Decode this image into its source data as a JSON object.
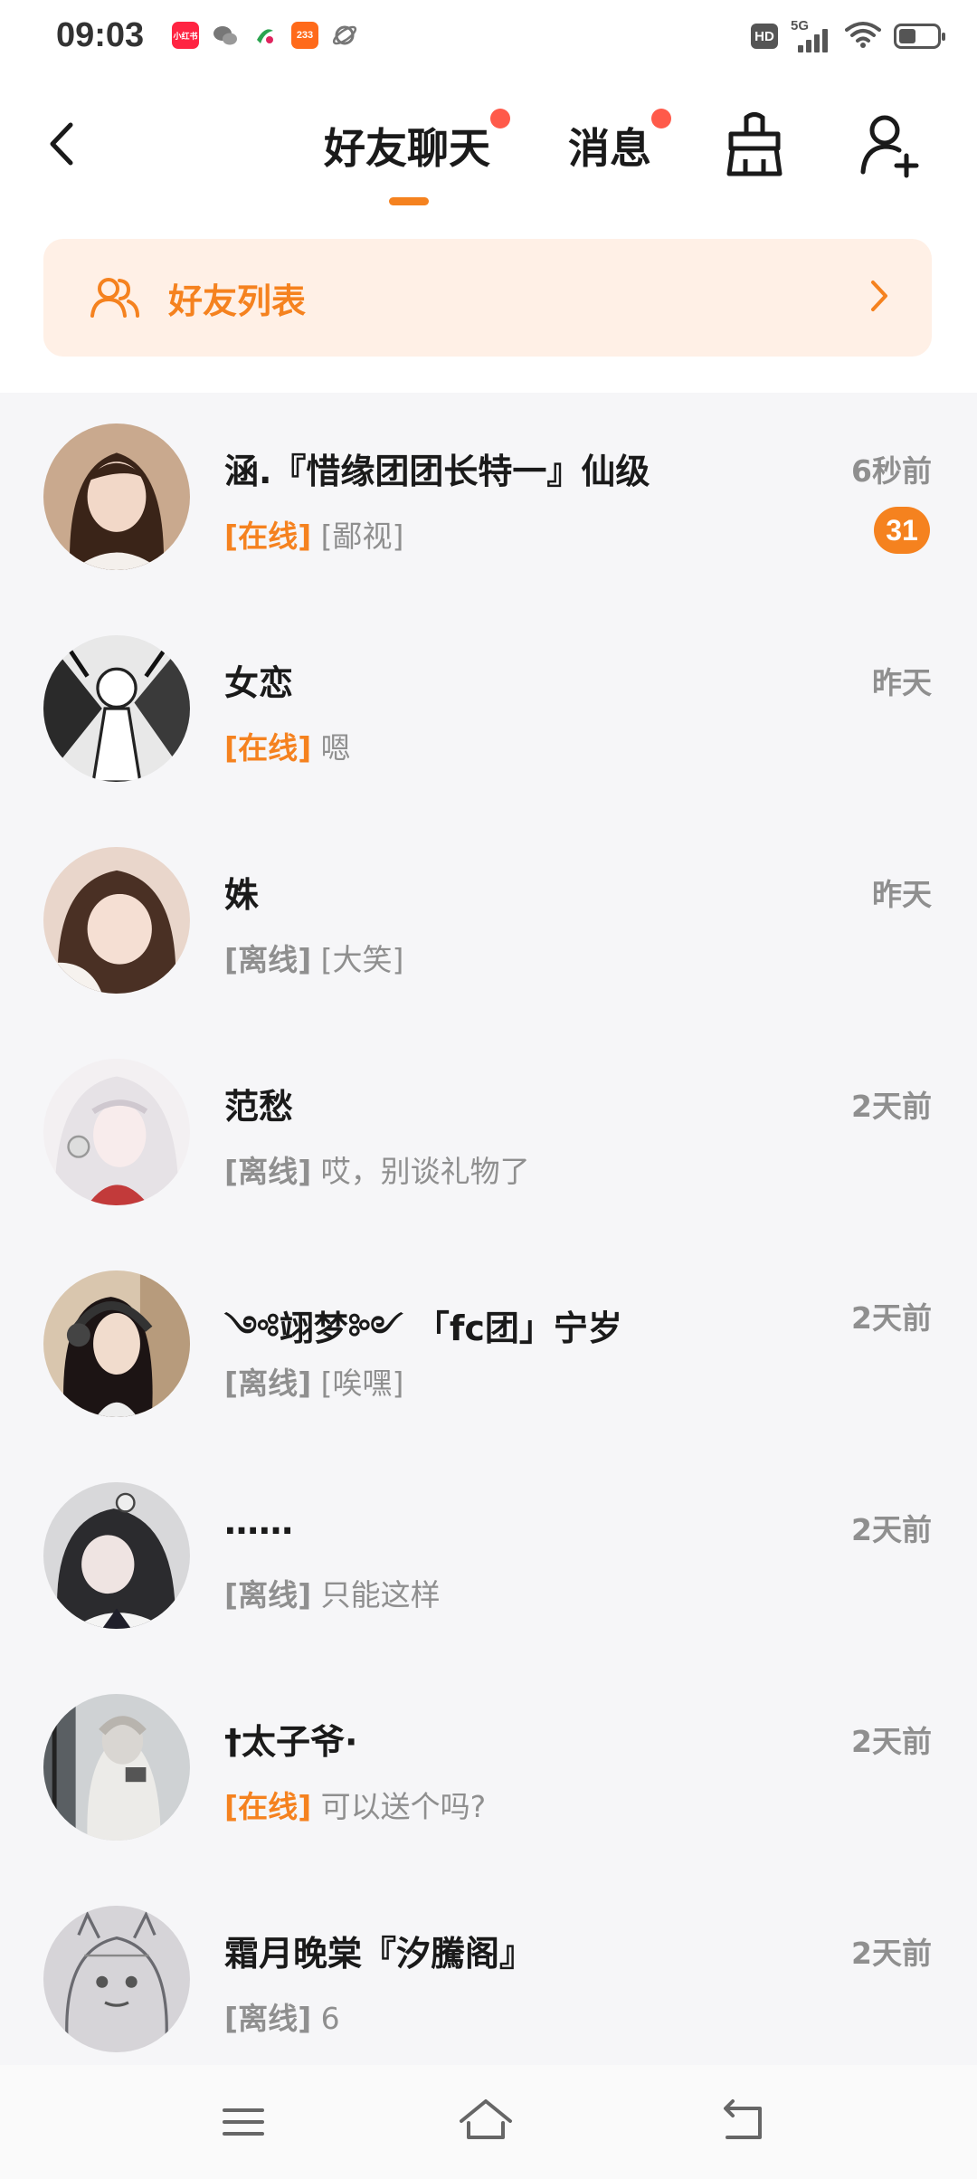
{
  "status_bar": {
    "time": "09:03",
    "hd": "HD",
    "network": "5G",
    "apps": [
      {
        "label": "小红书",
        "color": "#ff2442"
      },
      {
        "label": "",
        "color": "#9aa0a6"
      },
      {
        "label": "",
        "color": "#2aa44f"
      },
      {
        "label": "233",
        "color": "#ff6a1a"
      },
      {
        "label": "",
        "color": "#9aa0a6"
      }
    ]
  },
  "header": {
    "tabs": [
      {
        "label": "好友聊天",
        "active": true,
        "has_dot": true
      },
      {
        "label": "消息",
        "active": false,
        "has_dot": true
      }
    ],
    "icons": [
      "back-arrow-icon",
      "broom-icon",
      "add-friend-icon"
    ]
  },
  "banner": {
    "label": "好友列表"
  },
  "colors": {
    "accent": "#f5821f",
    "notification_dot": "#ff5a4a",
    "banner_bg": "#fff0e6"
  },
  "chats": [
    {
      "name": "涵.『惜缘团团长特一』仙级",
      "status": "[在线]",
      "online": true,
      "message": "[鄙视]",
      "time": "6秒前",
      "unread": "31"
    },
    {
      "name": "女恋",
      "status": "[在线]",
      "online": true,
      "message": "嗯",
      "time": "昨天",
      "unread": ""
    },
    {
      "name": "姝",
      "status": "[离线]",
      "online": false,
      "message": "[大笑]",
      "time": "昨天",
      "unread": ""
    },
    {
      "name": "范愁",
      "status": "[离线]",
      "online": false,
      "message": "哎，别谈礼物了",
      "time": "2天前",
      "unread": ""
    },
    {
      "name": "༺翊梦༻ 「fc团」宁岁",
      "status": "[离线]",
      "online": false,
      "message": "[唉嘿]",
      "time": "2天前",
      "unread": ""
    },
    {
      "name": "……",
      "status": "[离线]",
      "online": false,
      "message": "只能这样",
      "time": "2天前",
      "unread": ""
    },
    {
      "name": "†太子爷·",
      "status": "[在线]",
      "online": true,
      "message": "可以送个吗?",
      "time": "2天前",
      "unread": ""
    },
    {
      "name": "霜月晚棠『汐騰阁』",
      "status": "[离线]",
      "online": false,
      "message": "6",
      "time": "2天前",
      "unread": ""
    }
  ]
}
